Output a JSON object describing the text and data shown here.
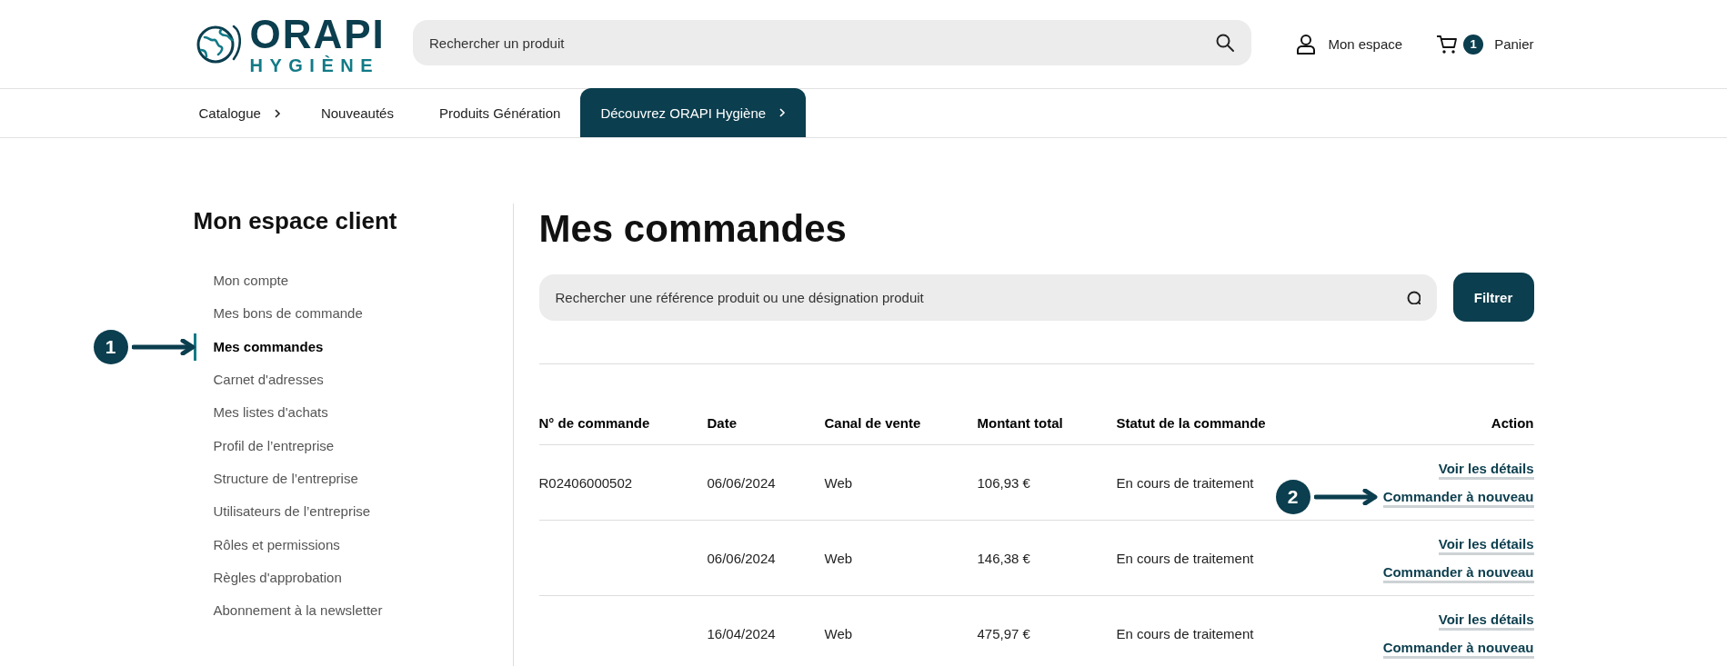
{
  "header": {
    "logo": {
      "line1": "ORAPI",
      "line2": "HYGIÈNE"
    },
    "search": {
      "placeholder": "Rechercher un produit"
    },
    "account": "Mon espace",
    "cart": {
      "count": "1",
      "label": "Panier"
    }
  },
  "nav": [
    {
      "label": "Catalogue",
      "chevron": true,
      "highlighted": false
    },
    {
      "label": "Nouveautés",
      "chevron": false,
      "highlighted": false
    },
    {
      "label": "Produits Génération",
      "chevron": false,
      "highlighted": false
    },
    {
      "label": "Découvrez ORAPI Hygiène",
      "chevron": true,
      "highlighted": true
    }
  ],
  "sidebar": {
    "title": "Mon espace client",
    "items": [
      {
        "label": "Mon compte",
        "selected": false
      },
      {
        "label": "Mes bons de commande",
        "selected": false
      },
      {
        "label": "Mes commandes",
        "selected": true,
        "callout": "1"
      },
      {
        "label": "Carnet d'adresses",
        "selected": false
      },
      {
        "label": "Mes listes d'achats",
        "selected": false
      },
      {
        "label": "Profil de l’entreprise",
        "selected": false
      },
      {
        "label": "Structure de l’entreprise",
        "selected": false
      },
      {
        "label": "Utilisateurs de l’entreprise",
        "selected": false
      },
      {
        "label": "Rôles et permissions",
        "selected": false
      },
      {
        "label": "Règles d'approbation",
        "selected": false
      },
      {
        "label": "Abonnement à la newsletter",
        "selected": false
      }
    ]
  },
  "main": {
    "title": "Mes commandes",
    "search": {
      "placeholder": "Rechercher une référence produit ou une désignation produit"
    },
    "filter_button": "Filtrer",
    "table": {
      "columns": [
        "N° de commande",
        "Date",
        "Canal de vente",
        "Montant total",
        "Statut de la commande",
        "Action"
      ],
      "rows": [
        {
          "cells": [
            "R02406000502",
            "06/06/2024",
            "Web",
            "106,93 €",
            "En cours de traitement"
          ],
          "actions": [
            {
              "label": "Voir les détails"
            },
            {
              "label": "Commander à nouveau",
              "callout": "2"
            }
          ]
        },
        {
          "cells": [
            "",
            "06/06/2024",
            "Web",
            "146,38 €",
            "En cours de traitement"
          ],
          "actions": [
            {
              "label": "Voir les détails"
            },
            {
              "label": "Commander à nouveau"
            }
          ]
        },
        {
          "cells": [
            "",
            "16/04/2024",
            "Web",
            "475,97 €",
            "En cours de traitement"
          ],
          "actions": [
            {
              "label": "Voir les détails"
            },
            {
              "label": "Commander à nouveau"
            }
          ]
        }
      ]
    }
  }
}
